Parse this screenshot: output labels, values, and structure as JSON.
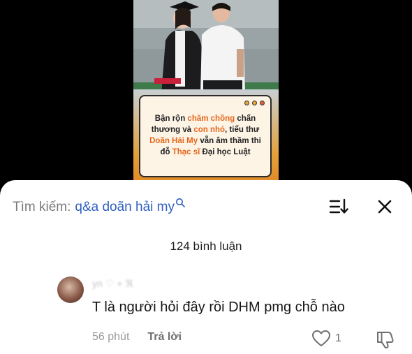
{
  "video": {
    "banner_segments": [
      {
        "text": "Bận rộn ",
        "highlight": false
      },
      {
        "text": "chăm chồng",
        "highlight": true
      },
      {
        "text": " chấn thương và ",
        "highlight": false
      },
      {
        "text": "con nhỏ",
        "highlight": true
      },
      {
        "text": ", tiểu thư ",
        "highlight": false
      },
      {
        "text": "Doãn Hải My",
        "highlight": true
      },
      {
        "text": " vẫn âm thầm thi đỗ ",
        "highlight": false
      },
      {
        "text": "Thạc sĩ",
        "highlight": true
      },
      {
        "text": " Đại học Luật",
        "highlight": false
      }
    ],
    "dot_colors": [
      "#e8a33a",
      "#e8a33a",
      "#e0623a"
    ]
  },
  "comments": {
    "search_label": "Tìm kiếm:",
    "search_query": "q&a doãn hải my",
    "count_label": "124 bình luận",
    "items": [
      {
        "username": "yn ♡ + ℜ",
        "text": "T là người hỏi đây rồi DHM pmg chỗ nào",
        "time": "56 phút",
        "reply_label": "Trả lời",
        "like_count": "1"
      }
    ]
  },
  "icons": {
    "search": "search-icon",
    "sort": "sort-icon",
    "close": "close-icon",
    "like": "heart-icon",
    "dislike": "dislike-icon"
  },
  "colors": {
    "highlight": "#e6661c",
    "search_query": "#2f5fbf"
  }
}
